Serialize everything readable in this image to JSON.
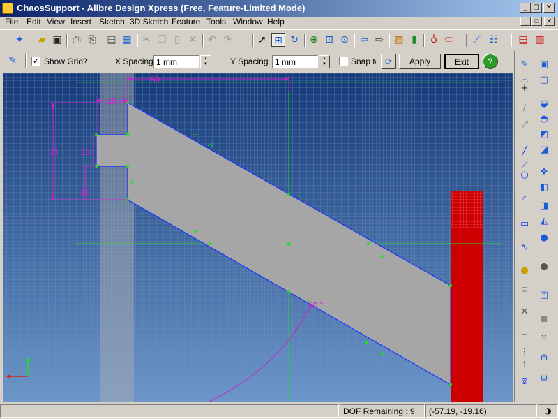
{
  "window": {
    "title": "ChaosSupport - Alibre Design Xpress (Free, Feature-Limited Mode)",
    "minimize": "_",
    "maximize": "□",
    "close": "✕"
  },
  "menu": {
    "items": [
      "File",
      "Edit",
      "View",
      "Insert",
      "Sketch",
      "3D Sketch",
      "Feature",
      "Tools",
      "Window",
      "Help"
    ]
  },
  "options_bar": {
    "show_grid_label": "Show Grid?",
    "show_grid_checked": true,
    "x_spacing_label": "X Spacing",
    "x_spacing_value": "1 mm",
    "y_spacing_label": "Y Spacing",
    "y_spacing_value": "1 mm",
    "snap_label": "Snap to",
    "apply_label": "Apply",
    "exit_label": "Exit",
    "help_label": "?"
  },
  "dimensions": {
    "top_width": "50",
    "left_width": "10",
    "height": "30",
    "inner_height": "10",
    "bottom_height": "10",
    "angle": "60 °"
  },
  "status": {
    "dof": "DOF Remaining : 9",
    "coords": "(-57.19, -19.16)"
  },
  "colors": {
    "title_start": "#0a246a",
    "title_end": "#a6caf0",
    "canvas_bg": "#3e6aa0",
    "sketch_fill": "#a6a6a6",
    "sketch_edge": "#1a33ff",
    "dimension": "#cc22cc",
    "constraint": "#22dd22",
    "red_body": "#cc0000"
  }
}
